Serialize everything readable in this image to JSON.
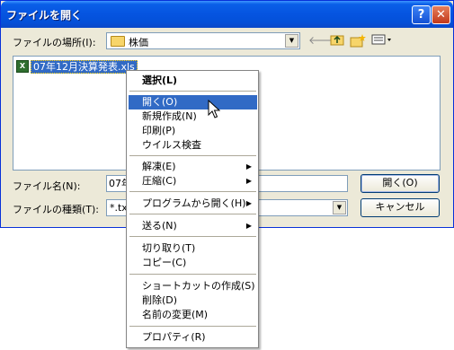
{
  "window": {
    "title": "ファイルを開く",
    "help_label": "?",
    "close_label": "✕"
  },
  "location": {
    "label": "ファイルの場所(I):",
    "value": "株価"
  },
  "files": [
    {
      "name": "07年12月決算発表.xls",
      "icon": "excel-file-icon"
    }
  ],
  "filename": {
    "label": "ファイル名(N):",
    "value": "07年"
  },
  "filetype": {
    "label": "ファイルの種類(T):",
    "value": "*.txt"
  },
  "buttons": {
    "open": "開く(O)",
    "cancel": "キャンセル"
  },
  "context_menu": {
    "items": [
      {
        "label": "選択(L)",
        "bold": true
      },
      {
        "label": "開く(O)",
        "highlighted": true
      },
      {
        "label": "新規作成(N)"
      },
      {
        "label": "印刷(P)"
      },
      {
        "label": "ウイルス検査"
      },
      {
        "label": "解凍(E)",
        "submenu": true
      },
      {
        "label": "圧縮(C)",
        "submenu": true
      },
      {
        "label": "プログラムから開く(H)",
        "submenu": true
      },
      {
        "label": "送る(N)",
        "submenu": true
      },
      {
        "label": "切り取り(T)"
      },
      {
        "label": "コピー(C)"
      },
      {
        "label": "ショートカットの作成(S)"
      },
      {
        "label": "削除(D)"
      },
      {
        "label": "名前の変更(M)"
      },
      {
        "label": "プロパティ(R)"
      }
    ]
  },
  "colors": {
    "titlebar": "#0554e0",
    "selection": "#316ac5",
    "dialog_bg": "#ece9d8"
  }
}
